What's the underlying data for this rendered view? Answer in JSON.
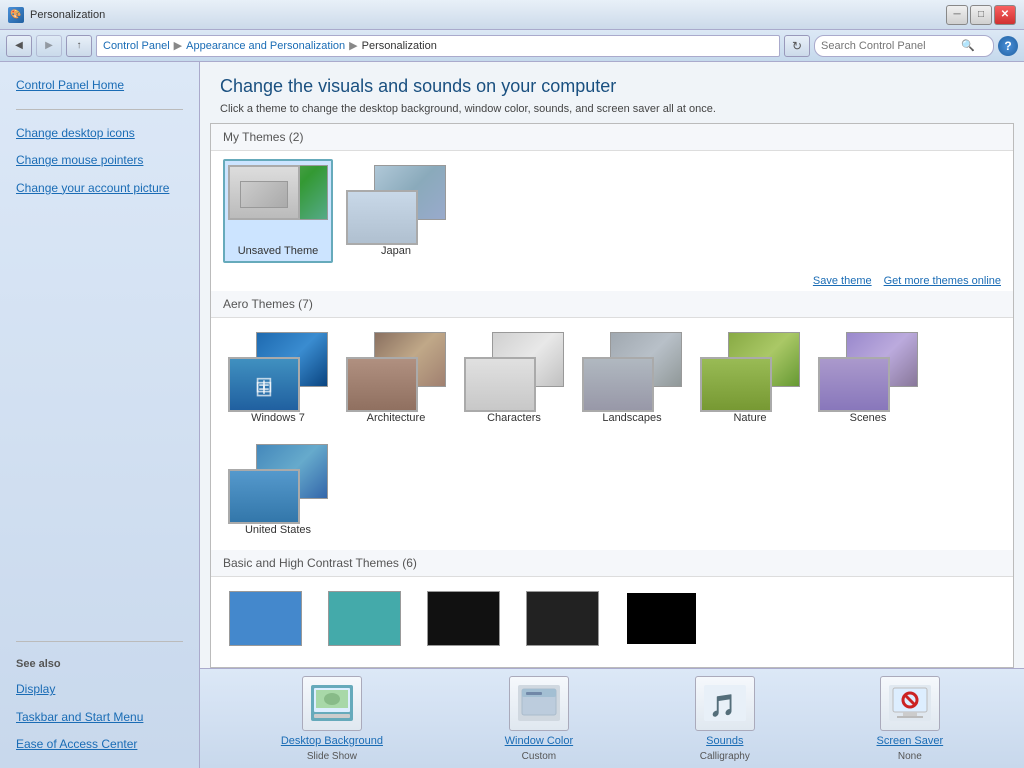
{
  "window": {
    "title": "Personalization",
    "controls": {
      "minimize": "─",
      "maximize": "□",
      "close": "✕"
    }
  },
  "addressBar": {
    "breadcrumbs": [
      "Control Panel",
      "Appearance and Personalization",
      "Personalization"
    ],
    "searchPlaceholder": "Search Control Panel"
  },
  "sidebar": {
    "mainLinks": [
      {
        "id": "control-panel-home",
        "label": "Control Panel Home"
      }
    ],
    "links": [
      {
        "id": "change-desktop-icons",
        "label": "Change desktop icons"
      },
      {
        "id": "change-mouse-pointers",
        "label": "Change mouse pointers"
      },
      {
        "id": "change-account-picture",
        "label": "Change your account picture"
      }
    ],
    "seeAlsoTitle": "See also",
    "seeAlsoLinks": [
      {
        "id": "display",
        "label": "Display"
      },
      {
        "id": "taskbar",
        "label": "Taskbar and Start Menu"
      },
      {
        "id": "ease-access",
        "label": "Ease of Access Center"
      }
    ]
  },
  "content": {
    "title": "Change the visuals and sounds on your computer",
    "subtitle": "Click a theme to change the desktop background, window color, sounds, and screen saver all at once."
  },
  "themes": {
    "myThemesHeader": "My Themes (2)",
    "saveThemeLabel": "Save theme",
    "getMoreLabel": "Get more themes online",
    "myThemes": [
      {
        "id": "unsaved",
        "label": "Unsaved Theme",
        "selected": true
      },
      {
        "id": "japan",
        "label": "Japan",
        "selected": false
      }
    ],
    "aeroHeader": "Aero Themes (7)",
    "aeroThemes": [
      {
        "id": "windows7",
        "label": "Windows 7"
      },
      {
        "id": "architecture",
        "label": "Architecture"
      },
      {
        "id": "characters",
        "label": "Characters"
      },
      {
        "id": "landscapes",
        "label": "Landscapes"
      },
      {
        "id": "nature",
        "label": "Nature"
      },
      {
        "id": "scenes",
        "label": "Scenes"
      },
      {
        "id": "united-states",
        "label": "United States"
      }
    ],
    "basicHeader": "Basic and High Contrast Themes (6)"
  },
  "toolbar": {
    "items": [
      {
        "id": "desktop-bg",
        "label": "Desktop Background",
        "sublabel": "Slide Show",
        "icon": "🌄"
      },
      {
        "id": "window-color",
        "label": "Window Color",
        "sublabel": "Custom",
        "icon": "🪟"
      },
      {
        "id": "sounds",
        "label": "Sounds",
        "sublabel": "Calligraphy",
        "icon": "🎵"
      },
      {
        "id": "screen-saver",
        "label": "Screen Saver",
        "sublabel": "None",
        "icon": "🚫"
      }
    ]
  }
}
